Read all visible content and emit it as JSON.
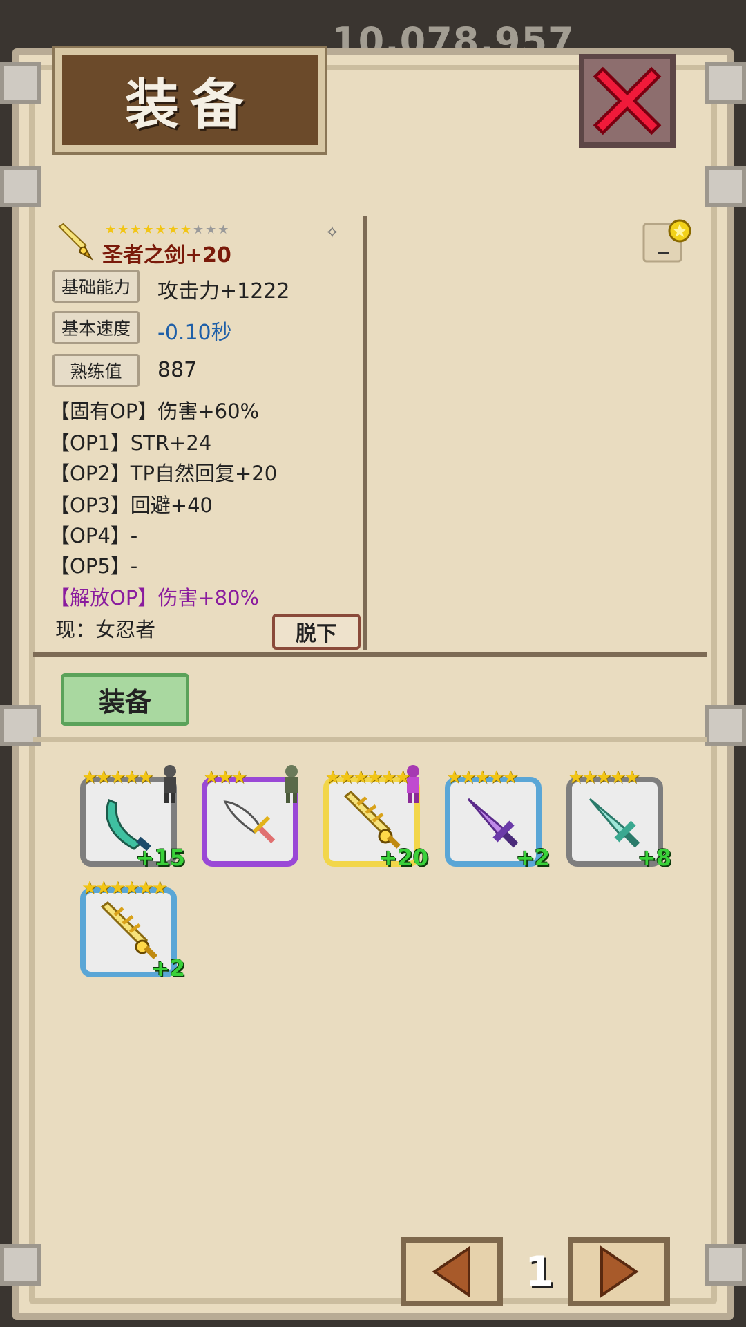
{
  "header": {
    "gold_amount": "10,078,957",
    "title": "装备"
  },
  "item": {
    "name": "圣者之剑+20",
    "stars_total": 10,
    "stars_filled": 7,
    "icon": "holy-sword-icon"
  },
  "stats": [
    {
      "label": "基础能力",
      "value": "攻击力+1222"
    },
    {
      "label": "基本速度",
      "value": "-0.10秒"
    },
    {
      "label": "熟练值",
      "value": "887"
    }
  ],
  "options": [
    {
      "text": "【固有OP】伤害+60%",
      "style": "normal"
    },
    {
      "text": "【OP1】STR+24",
      "style": "normal"
    },
    {
      "text": "【OP2】TP自然回复+20",
      "style": "normal"
    },
    {
      "text": "【OP3】回避+40",
      "style": "normal"
    },
    {
      "text": "【OP4】-",
      "style": "normal"
    },
    {
      "text": "【OP5】-",
      "style": "normal"
    },
    {
      "text": "【解放OP】伤害+80%",
      "style": "purple"
    }
  ],
  "current_owner": "现：女忍者",
  "buttons": {
    "unequip": "脱下",
    "equip": "装备"
  },
  "inventory": [
    {
      "plus": "+15",
      "stars": "★★★★★",
      "rarity": "gray",
      "weapon": "scimitar-icon",
      "owner": true
    },
    {
      "plus": "",
      "stars": "★★★",
      "rarity": "purple",
      "weapon": "cleaver-icon",
      "owner": true
    },
    {
      "plus": "+20",
      "stars": "★★★★★★",
      "rarity": "gold",
      "weapon": "holy-sword-icon",
      "owner": true
    },
    {
      "plus": "+2",
      "stars": "★★★★★",
      "rarity": "blue",
      "weapon": "purple-sword-icon",
      "owner": false
    },
    {
      "plus": "+8",
      "stars": "★★★★★",
      "rarity": "gray",
      "weapon": "crystal-sword-icon",
      "owner": false
    },
    {
      "plus": "+2",
      "stars": "★★★★★★",
      "rarity": "blue",
      "weapon": "golden-sword-icon",
      "owner": false
    }
  ],
  "pager": {
    "page": "1"
  },
  "colors": {
    "panel_bg": "#e9dcc0",
    "plus_green": "#3ad13a",
    "name_red": "#7a1a0a",
    "op_purple": "#8a1c9e"
  }
}
